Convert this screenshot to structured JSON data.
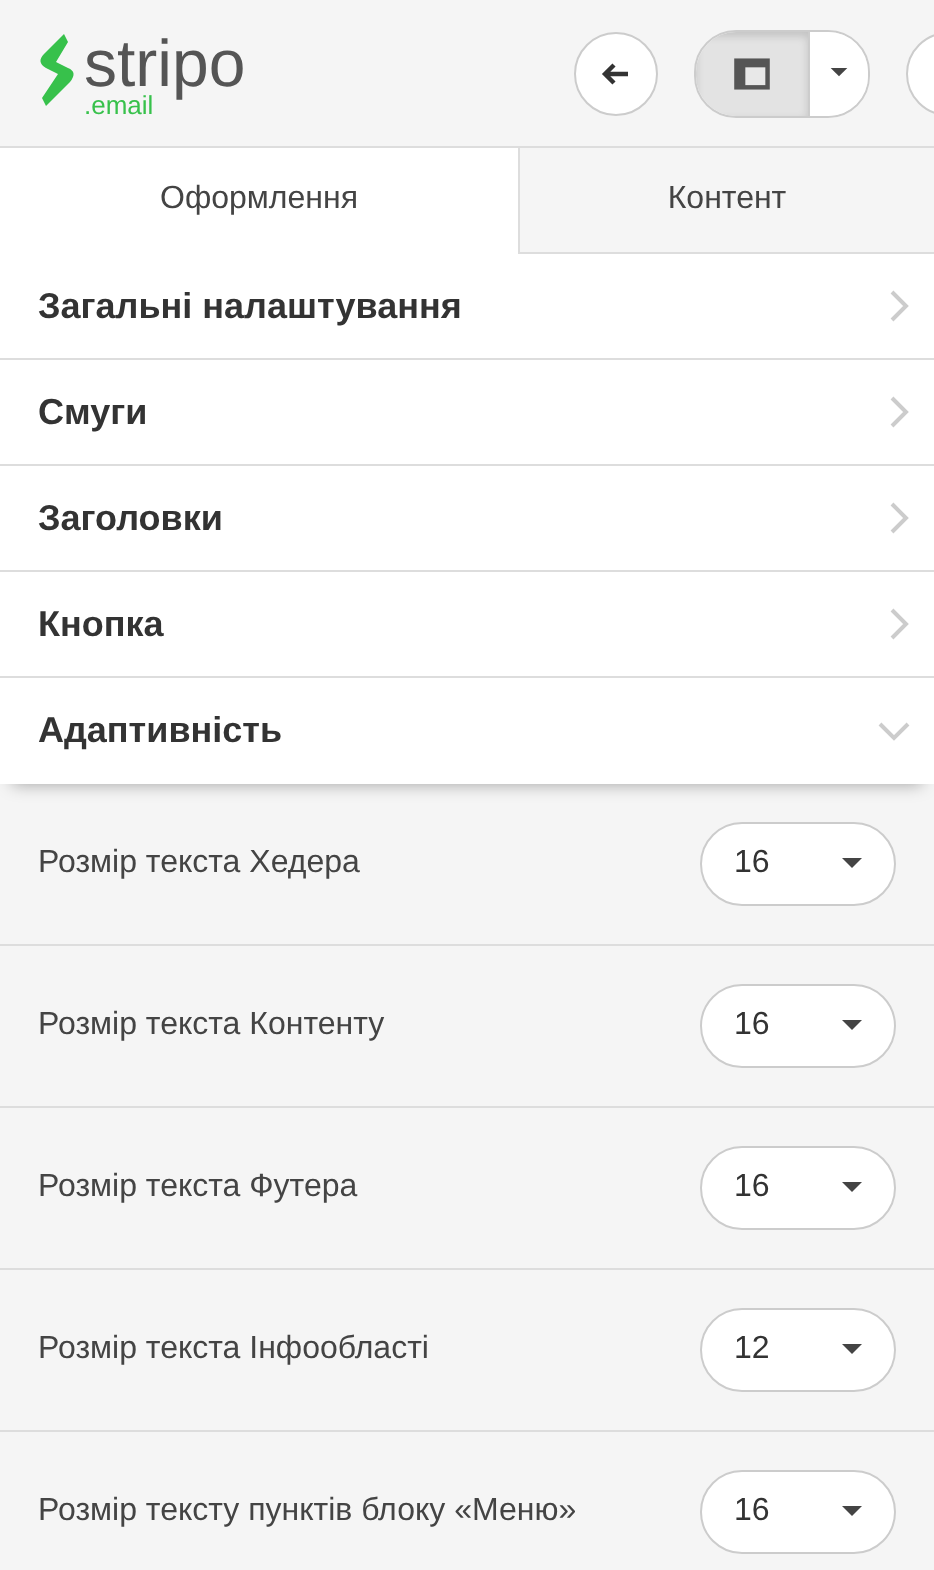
{
  "logo": {
    "name": "stripo",
    "domain": ".email"
  },
  "tabs": [
    {
      "label": "Оформлення",
      "selected": true
    },
    {
      "label": "Контент",
      "selected": false
    }
  ],
  "sections": [
    {
      "label": "Загальні налаштування",
      "expanded": false
    },
    {
      "label": "Смуги",
      "expanded": false
    },
    {
      "label": "Заголовки",
      "expanded": false
    },
    {
      "label": "Кнопка",
      "expanded": false
    },
    {
      "label": "Адаптивність",
      "expanded": true
    }
  ],
  "settings": [
    {
      "label": "Розмір текста Хедера",
      "value": "16"
    },
    {
      "label": "Розмір текста Контенту",
      "value": "16"
    },
    {
      "label": "Розмір текста Футера",
      "value": "16"
    },
    {
      "label": "Розмір текста Інфообласті",
      "value": "12"
    },
    {
      "label": "Розмір тексту пунктів блоку «Меню»",
      "value": "16"
    }
  ]
}
